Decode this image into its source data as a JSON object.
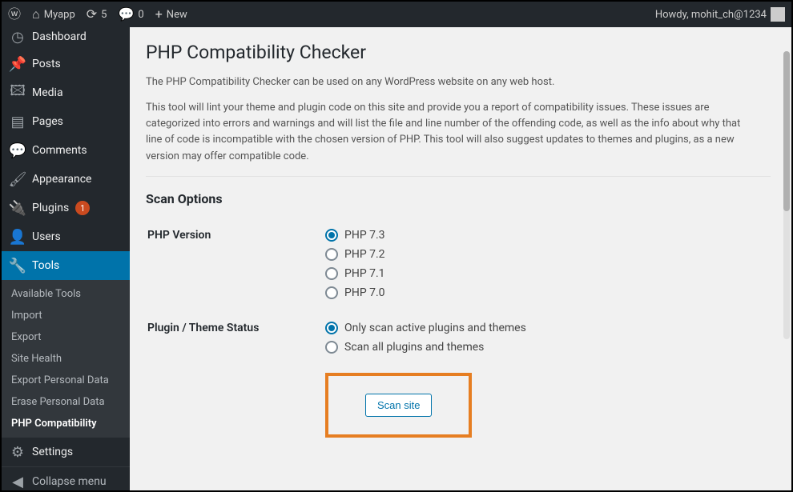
{
  "adminbar": {
    "site_name": "Myapp",
    "updates_count": "5",
    "comments_count": "0",
    "new_label": "New",
    "howdy": "Howdy, mohit_ch@1234"
  },
  "sidebar": {
    "items": [
      {
        "label": "Dashboard"
      },
      {
        "label": "Posts"
      },
      {
        "label": "Media"
      },
      {
        "label": "Pages"
      },
      {
        "label": "Comments"
      },
      {
        "label": "Appearance"
      },
      {
        "label": "Plugins",
        "badge": "1"
      },
      {
        "label": "Users"
      },
      {
        "label": "Tools",
        "current": true
      },
      {
        "label": "Settings"
      },
      {
        "label": "Collapse menu"
      }
    ],
    "submenu": [
      {
        "label": "Available Tools"
      },
      {
        "label": "Import"
      },
      {
        "label": "Export"
      },
      {
        "label": "Site Health"
      },
      {
        "label": "Export Personal Data"
      },
      {
        "label": "Erase Personal Data"
      },
      {
        "label": "PHP Compatibility",
        "current": true
      }
    ]
  },
  "page": {
    "title": "PHP Compatibility Checker",
    "intro": "The PHP Compatibility Checker can be used on any WordPress website on any web host.",
    "desc": "This tool will lint your theme and plugin code on this site and provide you a report of compatibility issues. These issues are categorized into errors and warnings and will list the file and line number of the offending code, as well as the info about why that line of code is incompatible with the chosen version of PHP. This tool will also suggest updates to themes and plugins, as a new version may offer compatible code.",
    "scan_options_heading": "Scan Options",
    "php_version_label": "PHP Version",
    "php_versions": [
      "PHP 7.3",
      "PHP 7.2",
      "PHP 7.1",
      "PHP 7.0"
    ],
    "php_selected": "PHP 7.3",
    "status_label": "Plugin / Theme Status",
    "status_options": [
      "Only scan active plugins and themes",
      "Scan all plugins and themes"
    ],
    "status_selected": "Only scan active plugins and themes",
    "scan_button": "Scan site"
  }
}
